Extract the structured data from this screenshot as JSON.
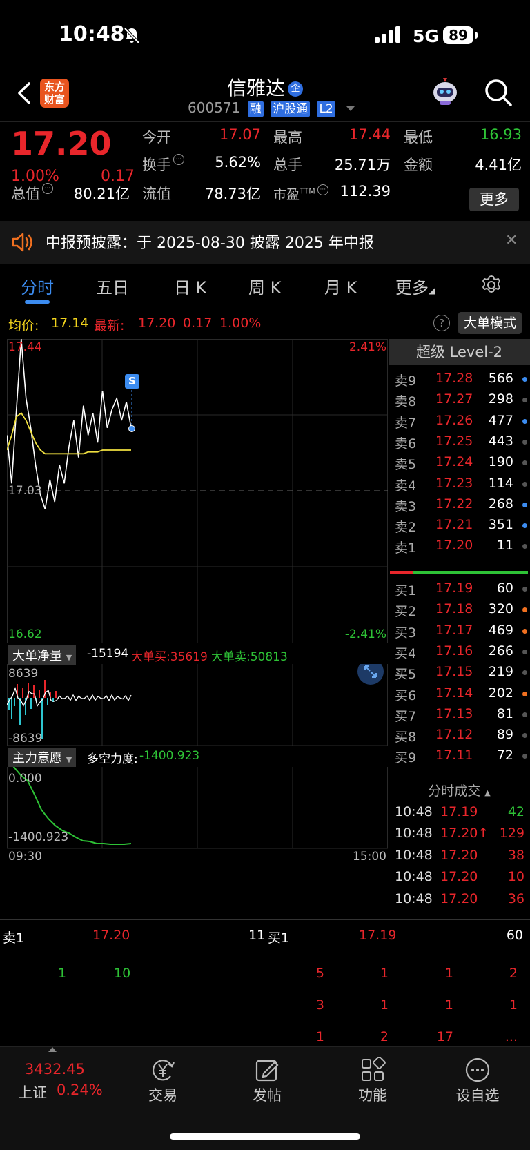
{
  "status": {
    "time": "10:48",
    "network": "5G",
    "battery": "89"
  },
  "header": {
    "logo": "东方财富",
    "title": "信雅达",
    "title_badge": "企",
    "code": "600571",
    "tags": [
      "融",
      "沪股通",
      "L2"
    ]
  },
  "quote": {
    "price": "17.20",
    "pct": "1.00%",
    "change": "0.17",
    "fields": [
      {
        "label": "今开",
        "value": "17.07",
        "color": "red"
      },
      {
        "label": "最高",
        "value": "17.44",
        "color": "red"
      },
      {
        "label": "最低",
        "value": "16.93",
        "color": "green"
      },
      {
        "label": "换手",
        "value": "5.62%",
        "color": "white"
      },
      {
        "label": "总手",
        "value": "25.71万",
        "color": "white"
      },
      {
        "label": "金额",
        "value": "4.41亿",
        "color": "white"
      },
      {
        "label": "总值",
        "value": "80.21亿",
        "color": "white"
      },
      {
        "label": "流值",
        "value": "78.73亿",
        "color": "white"
      },
      {
        "label": "市盈",
        "label_sup": "TTM",
        "value": "112.39",
        "color": "white"
      }
    ],
    "more": "更多"
  },
  "notice": {
    "text": "中报预披露：于 2025-08-30 披露 2025 年中报"
  },
  "tabs": [
    "分时",
    "五日",
    "日 K",
    "周 K",
    "月 K",
    "更多"
  ],
  "active_tab": 0,
  "avg": {
    "avg_label": "均价:",
    "avg_value": "17.14",
    "latest_label": "最新:",
    "latest_value": "17.20",
    "latest_change": "0.17",
    "latest_pct": "1.00%",
    "mode": "大单模式"
  },
  "chart": {
    "high": "17.44",
    "high_pct": "2.41%",
    "base": "17.03",
    "low": "16.62",
    "low_pct": "-2.41%",
    "signal": "S",
    "net_label": "大单净量",
    "net_value": "-15194",
    "buy_label": "大单买:35619",
    "sell_label": "大单卖:50813",
    "net_max": "8639",
    "net_min": "-8639",
    "intent_label": "主力意愿",
    "force_label": "多空力度:",
    "force_value": "-1400.923",
    "intent_top": "0.000",
    "intent_bottom": "-1400.923",
    "time_start": "09:30",
    "time_end": "15:00"
  },
  "chart_data": {
    "type": "line",
    "series": [
      {
        "name": "price",
        "values": [
          17.18,
          17.05,
          17.25,
          17.44,
          17.28,
          17.2,
          17.1,
          17.02,
          16.98,
          17.06,
          17.0,
          17.1,
          17.05,
          17.15,
          17.22,
          17.12,
          17.26,
          17.18,
          17.24,
          17.16,
          17.3,
          17.2,
          17.25,
          17.28,
          17.22,
          17.27,
          17.2
        ]
      },
      {
        "name": "avg",
        "values": [
          17.14,
          17.18,
          17.23,
          17.24,
          17.22,
          17.19,
          17.16,
          17.14,
          17.13,
          17.13,
          17.13,
          17.13,
          17.13,
          17.13,
          17.13,
          17.13,
          17.13,
          17.135,
          17.135,
          17.135,
          17.14,
          17.14,
          17.14,
          17.14,
          17.14,
          17.14,
          17.14
        ]
      }
    ],
    "ylim": [
      16.62,
      17.44
    ],
    "yref": 17.03
  },
  "level2": {
    "title": "超级 Level-2",
    "sells": [
      {
        "n": "卖9",
        "p": "17.28",
        "v": "566",
        "dot": "#3c8cf0"
      },
      {
        "n": "卖8",
        "p": "17.27",
        "v": "298",
        "dot": "#555"
      },
      {
        "n": "卖7",
        "p": "17.26",
        "v": "477",
        "dot": "#3c8cf0"
      },
      {
        "n": "卖6",
        "p": "17.25",
        "v": "443",
        "dot": "#555"
      },
      {
        "n": "卖5",
        "p": "17.24",
        "v": "190",
        "dot": "#555"
      },
      {
        "n": "卖4",
        "p": "17.23",
        "v": "114",
        "dot": "#555"
      },
      {
        "n": "卖3",
        "p": "17.22",
        "v": "268",
        "dot": "#3c8cf0"
      },
      {
        "n": "卖2",
        "p": "17.21",
        "v": "351",
        "dot": "#3c8cf0"
      },
      {
        "n": "卖1",
        "p": "17.20",
        "v": "11",
        "dot": "#555"
      }
    ],
    "buys": [
      {
        "n": "买1",
        "p": "17.19",
        "v": "60",
        "dot": "#555"
      },
      {
        "n": "买2",
        "p": "17.18",
        "v": "320",
        "dot": "#f07020"
      },
      {
        "n": "买3",
        "p": "17.17",
        "v": "469",
        "dot": "#f07020"
      },
      {
        "n": "买4",
        "p": "17.16",
        "v": "266",
        "dot": "#555"
      },
      {
        "n": "买5",
        "p": "17.15",
        "v": "219",
        "dot": "#555"
      },
      {
        "n": "买6",
        "p": "17.14",
        "v": "202",
        "dot": "#f07020"
      },
      {
        "n": "买7",
        "p": "17.13",
        "v": "81",
        "dot": "#555"
      },
      {
        "n": "买8",
        "p": "17.12",
        "v": "89",
        "dot": "#555"
      },
      {
        "n": "买9",
        "p": "17.11",
        "v": "72",
        "dot": "#555"
      }
    ],
    "trades_title": "分时成交",
    "trades": [
      {
        "t": "10:48",
        "p": "17.19",
        "v": "42",
        "pc": "red",
        "vc": "green"
      },
      {
        "t": "10:48",
        "p": "17.20↑",
        "v": "129",
        "pc": "red",
        "vc": "red"
      },
      {
        "t": "10:48",
        "p": "17.20",
        "v": "38",
        "pc": "red",
        "vc": "red"
      },
      {
        "t": "10:48",
        "p": "17.20",
        "v": "10",
        "pc": "red",
        "vc": "red"
      },
      {
        "t": "10:48",
        "p": "17.20",
        "v": "36",
        "pc": "red",
        "vc": "red"
      }
    ]
  },
  "queue": {
    "sell_label": "卖1",
    "sell_price": "17.20",
    "sell_vol": "11",
    "buy_label": "买1",
    "buy_price": "17.19",
    "buy_vol": "60",
    "sell_orders": [
      "1",
      "10"
    ],
    "buy_orders": [
      "5",
      "1",
      "1",
      "2",
      "3",
      "1",
      "1",
      "1",
      "1",
      "2",
      "17",
      "..."
    ]
  },
  "bottom_nav": {
    "index_value": "3432.45",
    "index_name": "上证",
    "index_pct": "0.24%",
    "items": [
      "交易",
      "发帖",
      "功能",
      "设自选"
    ]
  }
}
